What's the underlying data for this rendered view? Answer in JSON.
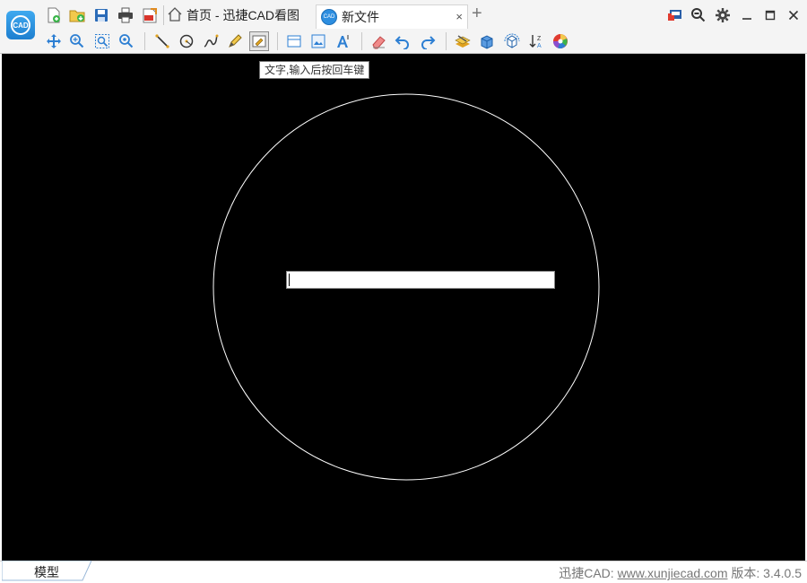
{
  "app": {
    "logo_text": "CAD"
  },
  "quick_access": [
    {
      "name": "new-file-icon"
    },
    {
      "name": "open-file-icon"
    },
    {
      "name": "save-icon"
    },
    {
      "name": "print-icon"
    },
    {
      "name": "export-pdf-icon"
    }
  ],
  "tabs": {
    "home": {
      "label": "首页 - 迅捷CAD看图"
    },
    "file": {
      "label": "新文件",
      "icon_text": "CAD"
    },
    "add_label": "+",
    "close_label": "×"
  },
  "window_controls": [
    "layout-icon",
    "zoom-icon",
    "settings-icon",
    "minimize-icon",
    "maximize-icon",
    "close-icon"
  ],
  "toolbar": {
    "tools": [
      "pan-icon",
      "zoom-realtime-icon",
      "zoom-window-icon",
      "zoom-extents-icon",
      "line-icon",
      "circle-icon",
      "polyline-icon",
      "pencil-icon",
      "text-icon",
      "measure-icon",
      "image-icon",
      "text-style-icon",
      "eraser-icon",
      "undo-icon",
      "redo-icon",
      "layers-icon",
      "3d-view-icon",
      "3d-orbit-icon",
      "sort-icon",
      "color-icon"
    ],
    "active_tool": "text-icon"
  },
  "canvas": {
    "background": "#000000",
    "tooltip": "文字,输入后按回车键",
    "text_input_value": ""
  },
  "statusbar": {
    "model_tab": "模型",
    "product_label": "迅捷CAD: ",
    "website": "www.xunjiecad.com",
    "version_label": " 版本: ",
    "version": "3.4.0.5"
  },
  "colors": {
    "accent": "#1e7fd0",
    "canvas": "#000000",
    "toolbar": "#f4f4f4"
  }
}
